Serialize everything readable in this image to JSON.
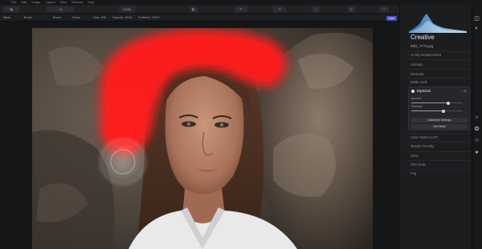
{
  "menu": {
    "items": [
      "File",
      "Edit",
      "Image",
      "Layers",
      "View",
      "Window",
      "Help"
    ]
  },
  "toolbar": {
    "zoom": "100%"
  },
  "options": {
    "mask_label": "Mask",
    "brush_label": "Brush",
    "erase_label": "Erase",
    "size_label": "Size: 196",
    "opacity_label": "Opacity: 100%",
    "softness_label": "Softness: 100%",
    "save_label": "Save"
  },
  "panel": {
    "title": "Creative",
    "file_name": "IMG_7772.jpg",
    "sections_above": [
      "AI Sky Replacement",
      "Sunrays",
      "Dramatic",
      "Matte Look"
    ],
    "card": {
      "name": "Mystical",
      "slider1_label": "Amount",
      "slider1_value": 0.72,
      "slider2_label": "Shadows",
      "slider2_value": 0.62,
      "advanced_button": "Advanced Settings",
      "add_mask_button": "Add Mask"
    },
    "sections_below": [
      "Color Styles (LUT)",
      "Texture Overlay",
      "Glow",
      "Film Grain",
      "Fog"
    ]
  },
  "icons": {
    "rail": [
      "layers-icon",
      "adjust-icon",
      "sun-icon",
      "palette-icon",
      "smile-icon",
      "pro-icon"
    ]
  },
  "colors": {
    "mask": "#ff1a1a",
    "accent": "#4a52c9"
  }
}
